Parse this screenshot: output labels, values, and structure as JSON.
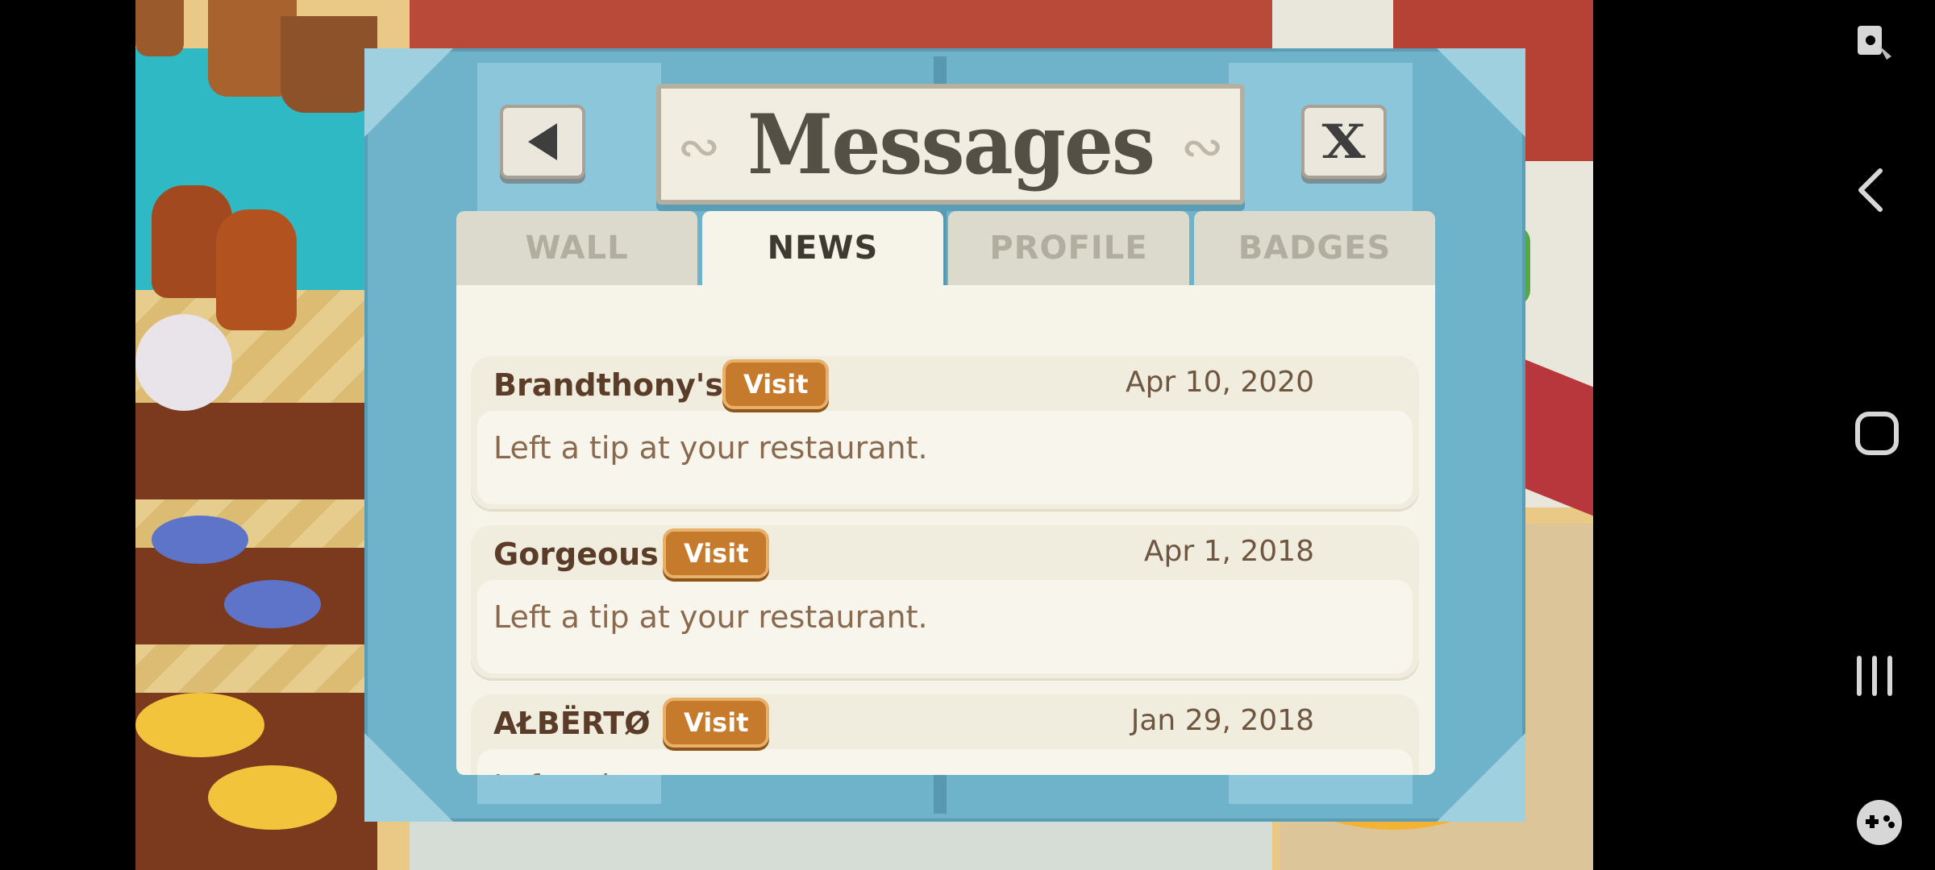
{
  "dialog": {
    "title": "Messages",
    "close_label": "X"
  },
  "tabs": [
    {
      "label": "WALL",
      "active": false
    },
    {
      "label": "NEWS",
      "active": true
    },
    {
      "label": "PROFILE",
      "active": false
    },
    {
      "label": "BADGES",
      "active": false
    }
  ],
  "messages": [
    {
      "sender": "Brandthony's",
      "visit_label": "Visit",
      "date": "Apr 10, 2020",
      "text": "Left a tip at your restaurant."
    },
    {
      "sender": "Gorgeous",
      "visit_label": "Visit",
      "date": "Apr 1, 2018",
      "text": "Left a tip at your restaurant."
    },
    {
      "sender": "AŁBËRTØ",
      "visit_label": "Visit",
      "date": "Jan 29, 2018",
      "text": "Left a tip at your restaurant."
    }
  ],
  "colors": {
    "dialog_frame": "#6fb3cb",
    "visit_button": "#c67a2c",
    "sender_text": "#5a3c28"
  },
  "system_icons": [
    "screenshot-tool-icon",
    "back-nav-icon",
    "home-nav-icon",
    "recents-nav-icon",
    "game-controller-icon"
  ]
}
